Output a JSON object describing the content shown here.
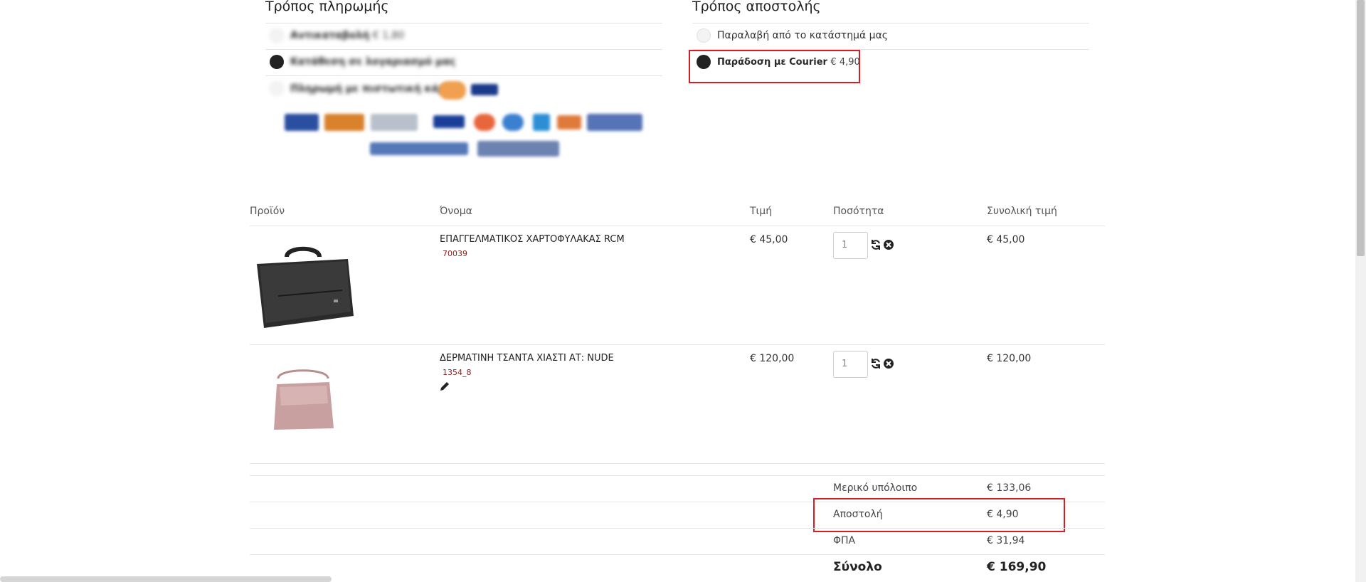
{
  "payment": {
    "title": "Τρόπος πληρωμής",
    "options": [
      {
        "label": "Αντικαταβολή",
        "price": "€ 1,80"
      },
      {
        "label": "Κατάθεση σε λογαριασμό μας",
        "price": ""
      },
      {
        "label": "Πληρωμή με πιστωτική κάρτα",
        "price": ""
      }
    ],
    "logos_row1": [
      "Verified by VISA",
      "MasterCard SecureCode",
      "SafeKey",
      "VISA",
      "mastercard",
      "maestro",
      "AMEX",
      "Discover",
      "Diners Club"
    ],
    "logos_row2": [
      "Alpha e-Commerce",
      "ALPHA BANK"
    ]
  },
  "shipping": {
    "title": "Τρόπος αποστολής",
    "options": [
      {
        "label": "Παραλαβή από το κατάστημά μας",
        "price": ""
      },
      {
        "label": "Παράδοση με Courier",
        "price": "€ 4,90"
      }
    ]
  },
  "cart": {
    "headers": {
      "product": "Προϊόν",
      "name": "Όνομα",
      "price": "Τιμή",
      "qty": "Ποσότητα",
      "total": "Συνολική τιμή"
    },
    "rows": [
      {
        "name": "ΕΠΑΓΓΕΛΜΑΤΙΚΟΣ ΧΑΡΤΟΦΥΛΑΚΑΣ RCM",
        "sku": "70039",
        "price": "€ 45,00",
        "qty": "1",
        "total": "€ 45,00",
        "image": "black-laptop-bag"
      },
      {
        "name": "ΔΕΡΜΑΤΙΝΗ ΤΣΑΝΤΑ ΧΙΑΣΤΙ ΑΤ: NUDE",
        "sku": "1354_8",
        "price": "€ 120,00",
        "qty": "1",
        "total": "€ 120,00",
        "image": "nude-leather-bag"
      }
    ]
  },
  "totals": [
    {
      "label": "Μερικό υπόλοιπο",
      "value": "€ 133,06"
    },
    {
      "label": "Αποστολή",
      "value": "€ 4,90"
    },
    {
      "label": "ΦΠΑ",
      "value": "€ 31,94"
    },
    {
      "label": "Σύνολο",
      "value": "€ 169,90"
    }
  ],
  "colors": {
    "highlight": "#d21f26",
    "sku": "#8a1c1c",
    "radio_selected": "#222222"
  },
  "icons": [
    "refresh-icon",
    "remove-icon",
    "edit-icon"
  ]
}
